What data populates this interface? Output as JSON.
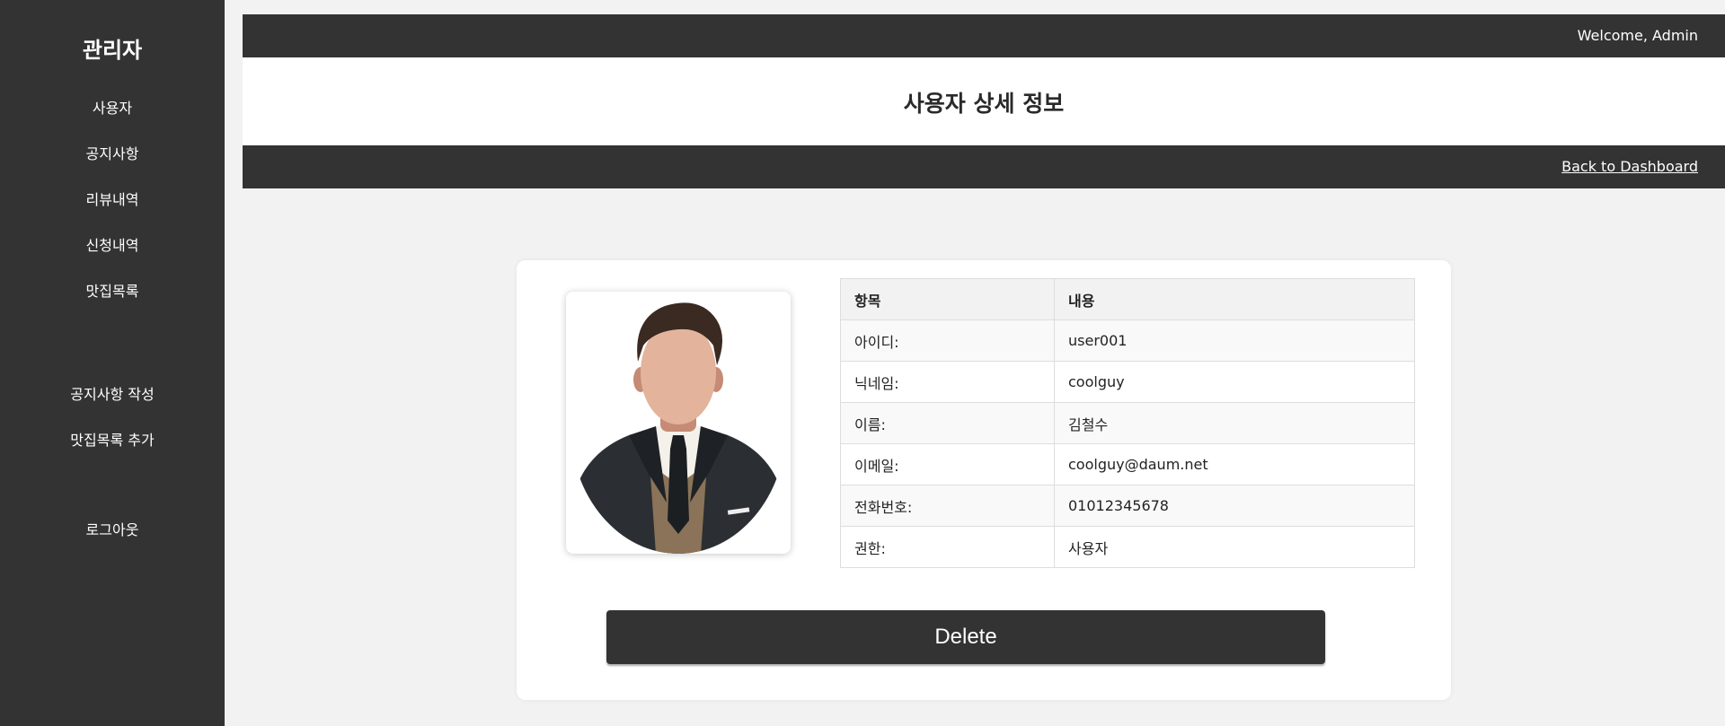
{
  "sidebar": {
    "title": "관리자",
    "nav": [
      "사용자",
      "공지사항",
      "리뷰내역",
      "신청내역",
      "맛집목록"
    ],
    "actions": [
      "공지사항 작성",
      "맛집목록 추가"
    ],
    "logout": "로그아웃"
  },
  "topbar": {
    "welcome": "Welcome, Admin"
  },
  "header": {
    "title": "사용자 상세 정보"
  },
  "linkbar": {
    "back_link": "Back to Dashboard"
  },
  "user_table": {
    "headers": [
      "항목",
      "내용"
    ],
    "rows": [
      [
        "아이디:",
        "user001"
      ],
      [
        "닉네임:",
        "coolguy"
      ],
      [
        "이름:",
        "김철수"
      ],
      [
        "이메일:",
        "coolguy@daum.net"
      ],
      [
        "전화번호:",
        "01012345678"
      ],
      [
        "권한:",
        "사용자"
      ]
    ]
  },
  "delete_button": "Delete",
  "colors": {
    "dark": "#333333",
    "background": "#f2f2f2",
    "card": "#ffffff"
  },
  "icons": {
    "avatar": "profile-avatar-illustration"
  }
}
